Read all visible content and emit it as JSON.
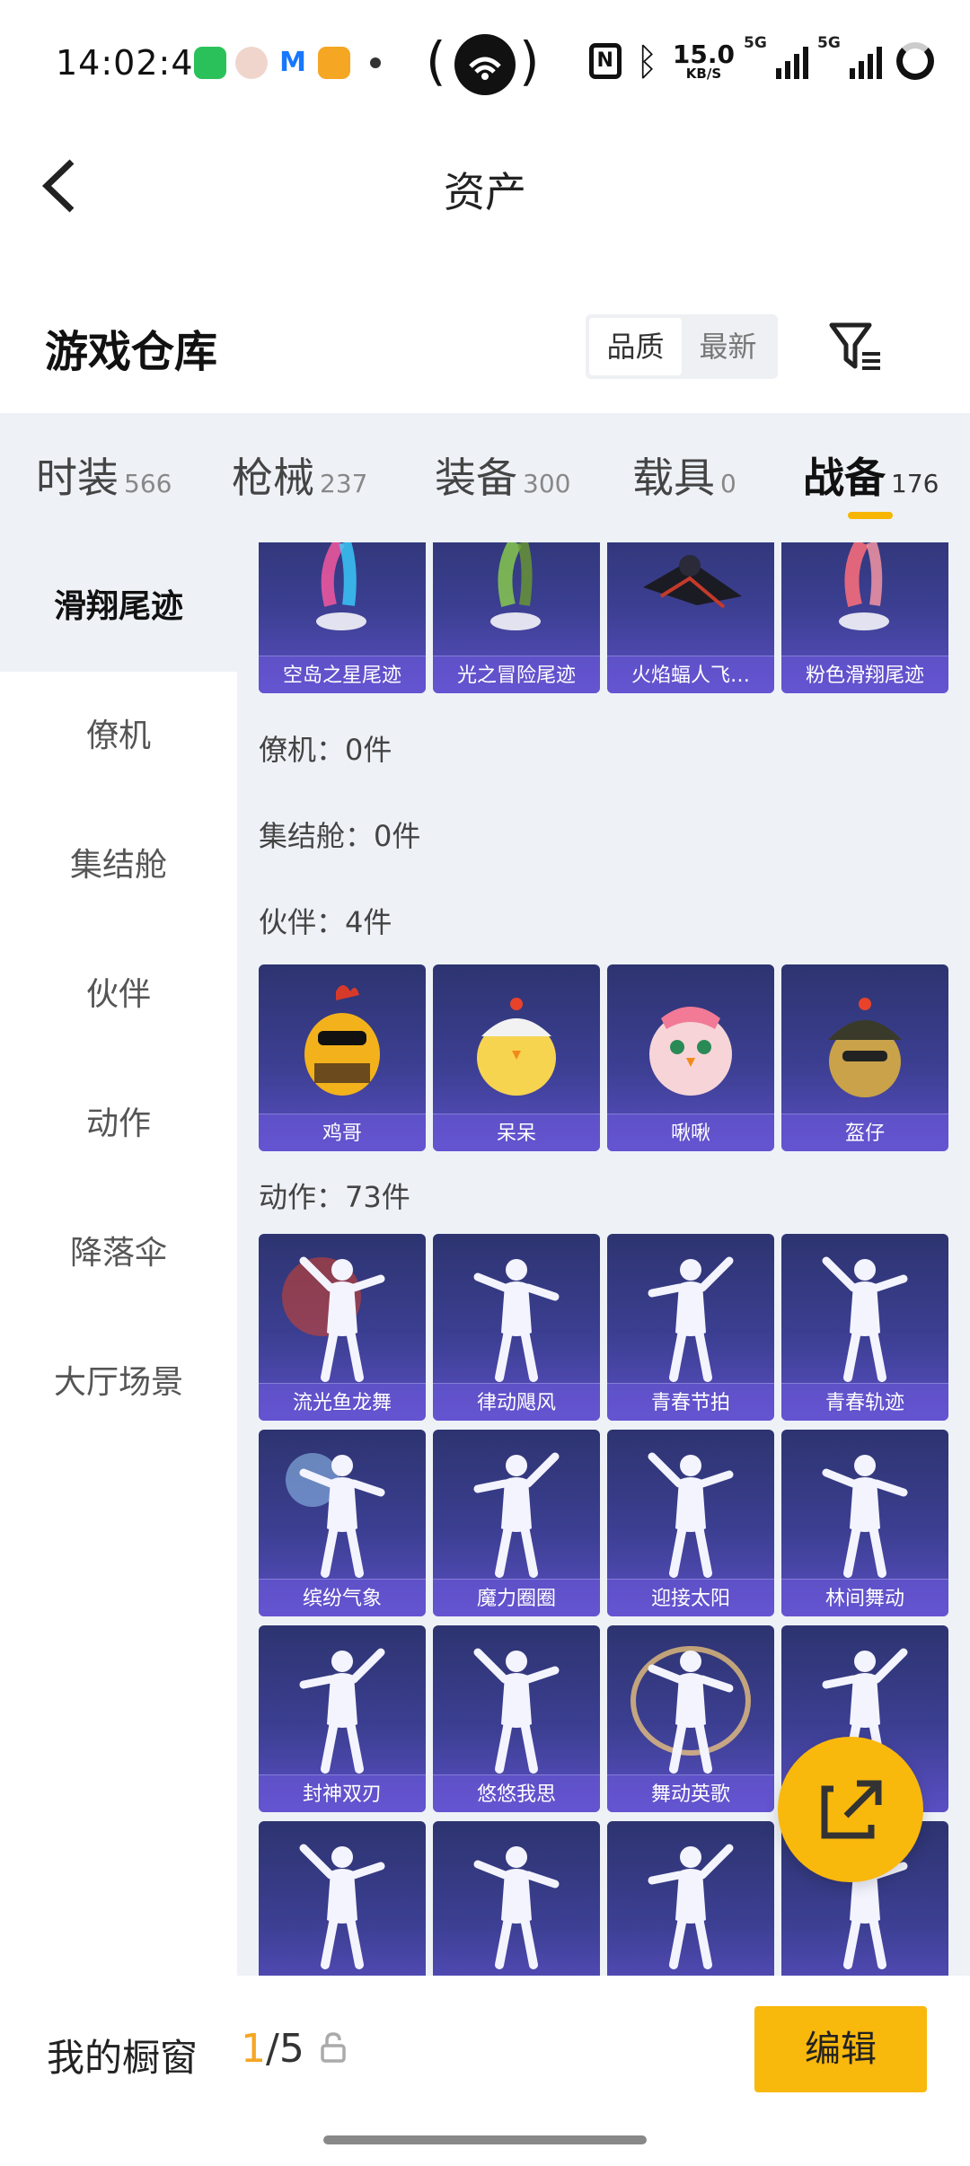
{
  "status_bar": {
    "time": "14:02:45",
    "net_speed_value": "15.0",
    "net_speed_unit": "KB/S",
    "sim1": "5G",
    "sim2": "5G"
  },
  "header": {
    "title": "资产"
  },
  "warehouse": {
    "title": "游戏仓库",
    "sort_options": [
      "品质",
      "最新"
    ],
    "active_sort": "品质"
  },
  "tabs": [
    {
      "label": "时装",
      "count": "566"
    },
    {
      "label": "枪械",
      "count": "237"
    },
    {
      "label": "装备",
      "count": "300"
    },
    {
      "label": "载具",
      "count": "0"
    },
    {
      "label": "战备",
      "count": "176"
    }
  ],
  "active_tab": "战备",
  "sidebar": {
    "items": [
      "滑翔尾迹",
      "僚机",
      "集结舱",
      "伙伴",
      "动作",
      "降落伞",
      "大厅场景"
    ],
    "active": "滑翔尾迹"
  },
  "sections": {
    "glide_trails": [
      "空岛之星尾迹",
      "光之冒险尾迹",
      "火焰蝠人飞…",
      "粉色滑翔尾迹"
    ],
    "wingman_label": "僚机：0件",
    "rally_pod_label": "集结舱：0件",
    "partner_label": "伙伴：4件",
    "partners": [
      "鸡哥",
      "呆呆",
      "啾啾",
      "盔仔"
    ],
    "emote_label": "动作：73件",
    "emotes": [
      "流光鱼龙舞",
      "律动飓风",
      "青春节拍",
      "青春轨迹",
      "缤纷气象",
      "魔力圈圈",
      "迎接太阳",
      "林间舞动",
      "封神双刃",
      "悠悠我思",
      "舞动英歌",
      "",
      "",
      "",
      "",
      ""
    ]
  },
  "bottom_bar": {
    "showcase_label": "我的橱窗",
    "showcase_current": "1",
    "showcase_total": "/5",
    "edit_label": "编辑"
  },
  "colors": {
    "accent": "#f9b80c",
    "panel_bg": "#eef2f7",
    "card_bg": "#3c3f92"
  }
}
